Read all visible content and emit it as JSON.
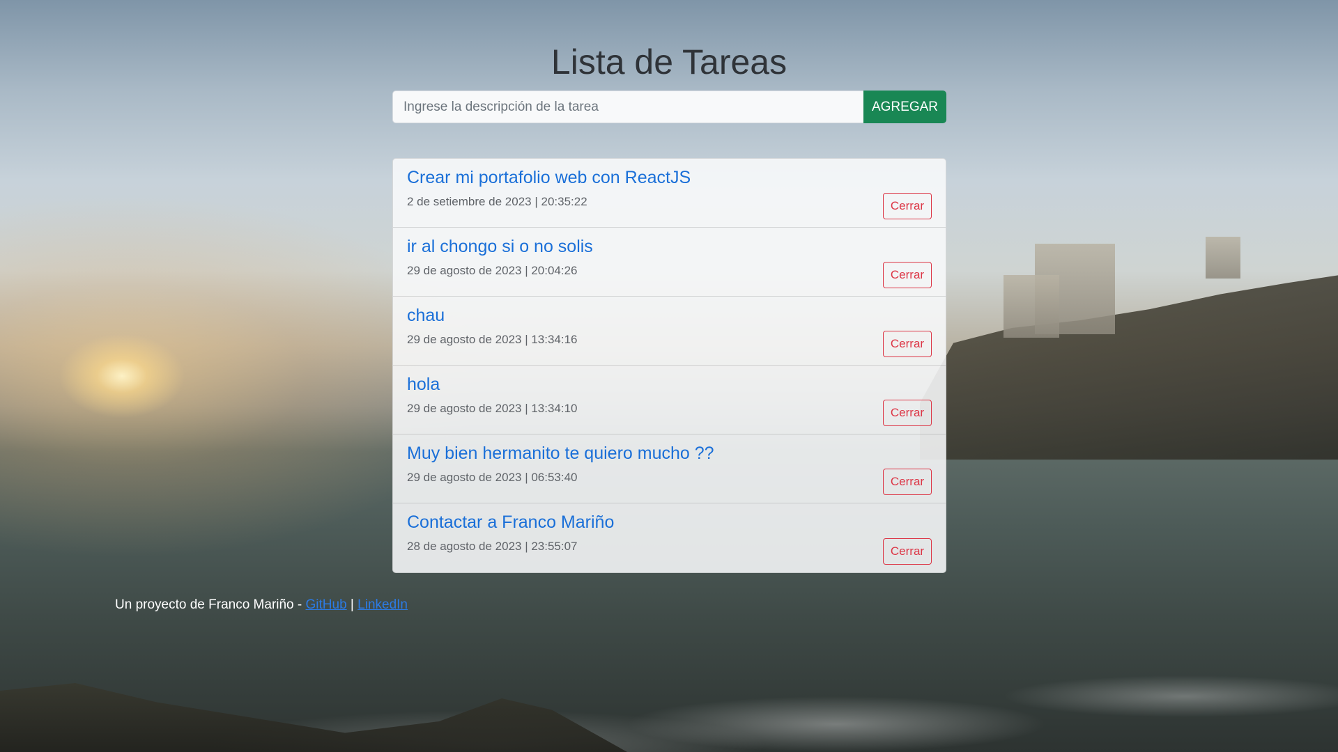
{
  "header": {
    "title": "Lista de Tareas"
  },
  "form": {
    "input_placeholder": "Ingrese la descripción de la tarea",
    "input_value": "",
    "add_button_label": "AGREGAR"
  },
  "tasks": [
    {
      "title": "Crear mi portafolio web con ReactJS",
      "date": "2 de setiembre de 2023 | 20:35:22",
      "close_label": "Cerrar"
    },
    {
      "title": "ir al chongo si o no solis",
      "date": "29 de agosto de 2023 | 20:04:26",
      "close_label": "Cerrar"
    },
    {
      "title": "chau",
      "date": "29 de agosto de 2023 | 13:34:16",
      "close_label": "Cerrar"
    },
    {
      "title": "hola",
      "date": "29 de agosto de 2023 | 13:34:10",
      "close_label": "Cerrar"
    },
    {
      "title": "Muy bien hermanito te quiero mucho ??",
      "date": "29 de agosto de 2023 | 06:53:40",
      "close_label": "Cerrar"
    },
    {
      "title": "Contactar a Franco Mariño",
      "date": "28 de agosto de 2023 | 23:55:07",
      "close_label": "Cerrar"
    }
  ],
  "footer": {
    "text": "Un proyecto de Franco Mariño - ",
    "github_label": "GitHub",
    "separator": " | ",
    "linkedin_label": "LinkedIn"
  },
  "colors": {
    "accent_green": "#198754",
    "link_blue": "#1a6fd8",
    "danger_red": "#dc3545"
  }
}
